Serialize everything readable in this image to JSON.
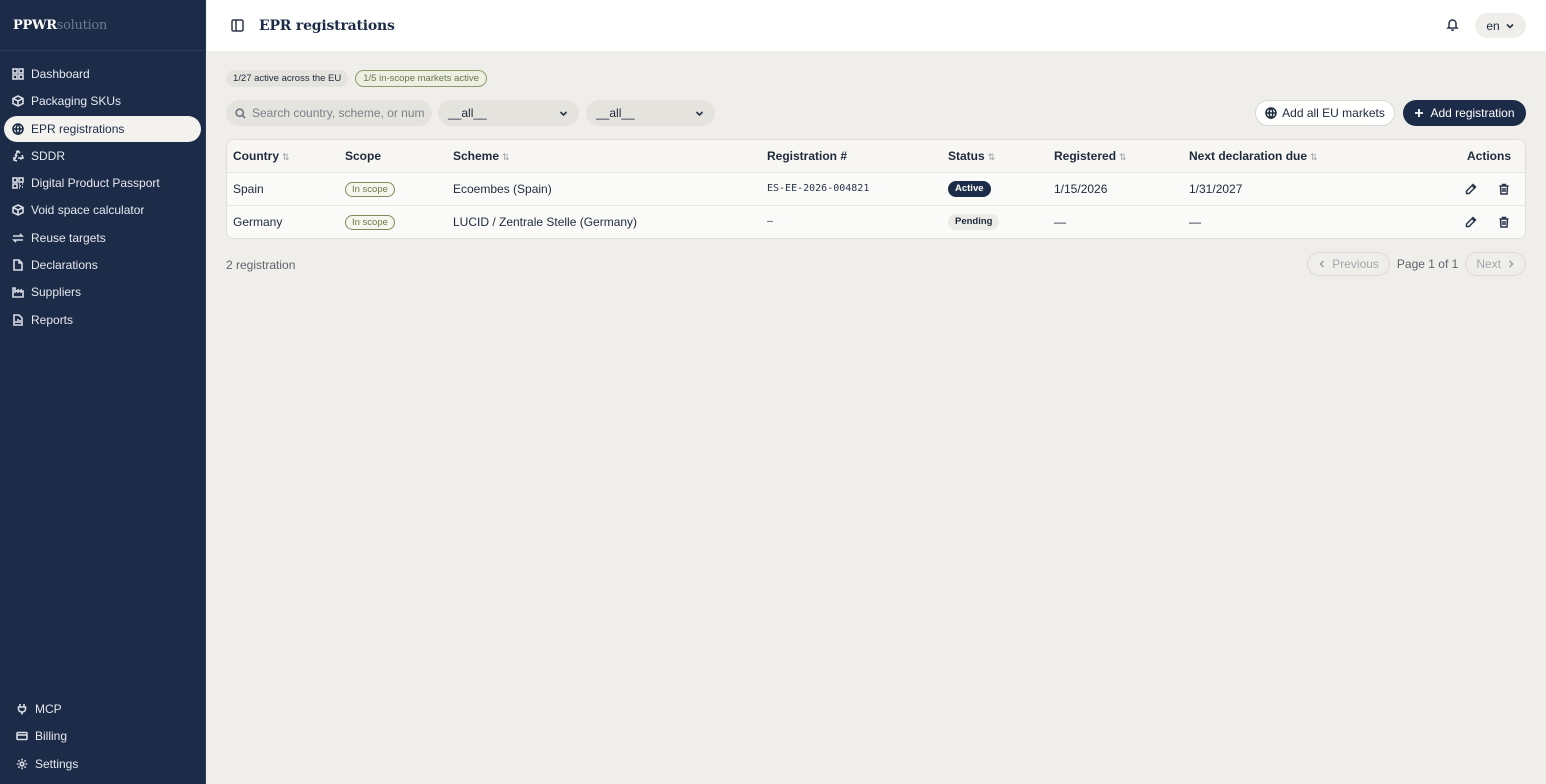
{
  "brand": {
    "name_bold": "PPWR",
    "name_light": "solution"
  },
  "nav": {
    "items": [
      {
        "label": "Dashboard",
        "icon": "dashboard-icon"
      },
      {
        "label": "Packaging SKUs",
        "icon": "package-icon"
      },
      {
        "label": "EPR registrations",
        "icon": "globe-icon",
        "active": true
      },
      {
        "label": "SDDR",
        "icon": "recycle-icon"
      },
      {
        "label": "Digital Product Passport",
        "icon": "qr-code-icon"
      },
      {
        "label": "Void space calculator",
        "icon": "box-icon"
      },
      {
        "label": "Reuse targets",
        "icon": "repeat-icon"
      },
      {
        "label": "Declarations",
        "icon": "file-icon"
      },
      {
        "label": "Suppliers",
        "icon": "factory-icon"
      },
      {
        "label": "Reports",
        "icon": "report-icon"
      }
    ],
    "bottom": [
      {
        "label": "MCP",
        "icon": "plug-icon"
      },
      {
        "label": "Billing",
        "icon": "credit-card-icon"
      },
      {
        "label": "Settings",
        "icon": "gear-icon"
      }
    ]
  },
  "header": {
    "title": "EPR registrations",
    "language": "en"
  },
  "summary": {
    "active_eu": "1/27 active across the EU",
    "in_scope": "1/5 in-scope markets active"
  },
  "filters": {
    "search_placeholder": "Search country, scheme, or number",
    "filter1_value": "__all__",
    "filter2_value": "__all__"
  },
  "buttons": {
    "add_all_eu": "Add all EU markets",
    "add_registration": "Add registration"
  },
  "table": {
    "columns": {
      "country": "Country",
      "scope": "Scope",
      "scheme": "Scheme",
      "registration": "Registration #",
      "status": "Status",
      "registered": "Registered",
      "next_due": "Next declaration due",
      "actions": "Actions"
    },
    "sort_glyph": "⇅",
    "rows": [
      {
        "country": "Spain",
        "scope": "In scope",
        "scheme": "Ecoembes (Spain)",
        "registration": "ES-EE-2026-004821",
        "status": "Active",
        "registered": "1/15/2026",
        "next_due": "1/31/2027"
      },
      {
        "country": "Germany",
        "scope": "In scope",
        "scheme": "LUCID / Zentrale Stelle (Germany)",
        "registration": "–",
        "status": "Pending",
        "registered": "—",
        "next_due": "—"
      }
    ]
  },
  "footer": {
    "count": "2 registration",
    "previous": "Previous",
    "page_info": "Page 1 of 1",
    "next": "Next"
  },
  "colors": {
    "sidebar_bg": "#1c2b47",
    "page_bg": "#efeeea",
    "accent": "#1c2b47",
    "scope_green": "#6e7b4b"
  }
}
